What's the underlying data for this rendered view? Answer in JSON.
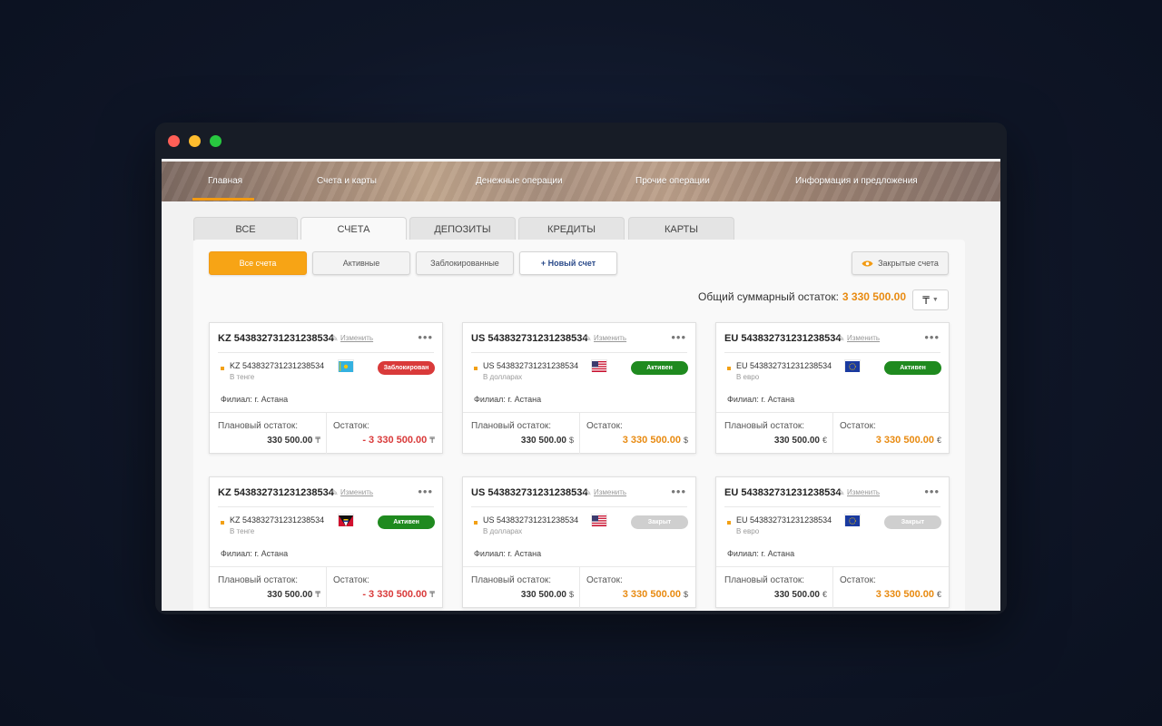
{
  "colors": {
    "accent": "#f29a12",
    "active_badge": "#1f8a1f",
    "blocked_badge": "#d93a3a",
    "closed_badge": "#cfcfcf",
    "negative": "#d93a3a",
    "positive": "#e88a10"
  },
  "nav": {
    "items": [
      "Главная",
      "Счета и карты",
      "Денежные операции",
      "Прочие операции",
      "Информация и предложения"
    ]
  },
  "tabs": [
    "ВСЕ",
    "СЧЕТА",
    "ДЕПОЗИТЫ",
    "КРЕДИТЫ",
    "КАРТЫ"
  ],
  "filters": {
    "all": "Все счета",
    "active": "Активные",
    "blocked": "Заблокированные",
    "new": "+ Новый счет",
    "closed": "Закрытые счета"
  },
  "summary": {
    "label": "Общий суммарный остаток:",
    "amount": "3 330 500.00",
    "currency_symbol": "₸"
  },
  "cards": [
    {
      "title": "KZ 543832731231238534",
      "edit": "Изменить",
      "account": "KZ 543832731231238534",
      "currency_name": "В тенге",
      "flag": "kz-flag-icon",
      "status": "Заблокирован",
      "status_type": "blocked",
      "branch": "Филиал: г. Астана",
      "plan_label": "Плановый остаток:",
      "plan_value": "330 500.00",
      "balance_label": "Остаток:",
      "balance_value": "- 3 330 500.00",
      "balance_type": "negative",
      "symbol": "₸"
    },
    {
      "title": "US 543832731231238534",
      "edit": "Изменить",
      "account": "US 543832731231238534",
      "currency_name": "В долларах",
      "flag": "us-flag-icon",
      "status": "Активен",
      "status_type": "active",
      "branch": "Филиал: г. Астана",
      "plan_label": "Плановый остаток:",
      "plan_value": "330 500.00",
      "balance_label": "Остаток:",
      "balance_value": "3 330 500.00",
      "balance_type": "positive",
      "symbol": "$"
    },
    {
      "title": "EU 543832731231238534",
      "edit": "Изменить",
      "account": "EU 543832731231238534",
      "currency_name": "В евро",
      "flag": "eu-flag-icon",
      "status": "Активен",
      "status_type": "active",
      "branch": "Филиал: г. Астана",
      "plan_label": "Плановый остаток:",
      "plan_value": "330 500.00",
      "balance_label": "Остаток:",
      "balance_value": "3 330 500.00",
      "balance_type": "positive",
      "symbol": "€"
    },
    {
      "title": "KZ 543832731231238534",
      "edit": "Изменить",
      "account": "KZ 543832731231238534",
      "currency_name": "В тенге",
      "flag": "ag-flag-icon",
      "status": "Активен",
      "status_type": "active",
      "branch": "Филиал: г. Астана",
      "plan_label": "Плановый остаток:",
      "plan_value": "330 500.00",
      "balance_label": "Остаток:",
      "balance_value": "- 3 330 500.00",
      "balance_type": "negative",
      "symbol": "₸"
    },
    {
      "title": "US 543832731231238534",
      "edit": "Изменить",
      "account": "US 543832731231238534",
      "currency_name": "В долларах",
      "flag": "us-flag-icon",
      "status": "Закрыт",
      "status_type": "closed",
      "branch": "Филиал: г. Астана",
      "plan_label": "Плановый остаток:",
      "plan_value": "330 500.00",
      "balance_label": "Остаток:",
      "balance_value": "3 330 500.00",
      "balance_type": "positive",
      "symbol": "$"
    },
    {
      "title": "EU 543832731231238534",
      "edit": "Изменить",
      "account": "EU 543832731231238534",
      "currency_name": "В евро",
      "flag": "eu-flag-icon",
      "status": "Закрыт",
      "status_type": "closed",
      "branch": "Филиал: г. Астана",
      "plan_label": "Плановый остаток:",
      "plan_value": "330 500.00",
      "balance_label": "Остаток:",
      "balance_value": "3 330 500.00",
      "balance_type": "positive",
      "symbol": "€"
    }
  ]
}
